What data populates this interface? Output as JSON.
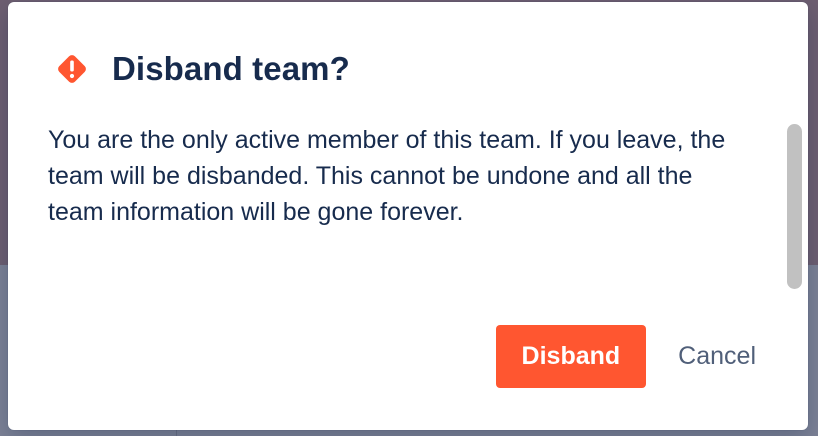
{
  "dialog": {
    "icon": "warning-icon",
    "title": "Disband team?",
    "message": "You are the only active member of this team. If you leave, the team will be disbanded. This cannot be undone and all the team information will be gone forever.",
    "primary_button": "Disband",
    "secondary_button": "Cancel"
  },
  "colors": {
    "accent": "#ff5630",
    "title_text": "#172b4d",
    "secondary_text": "#505f79"
  }
}
